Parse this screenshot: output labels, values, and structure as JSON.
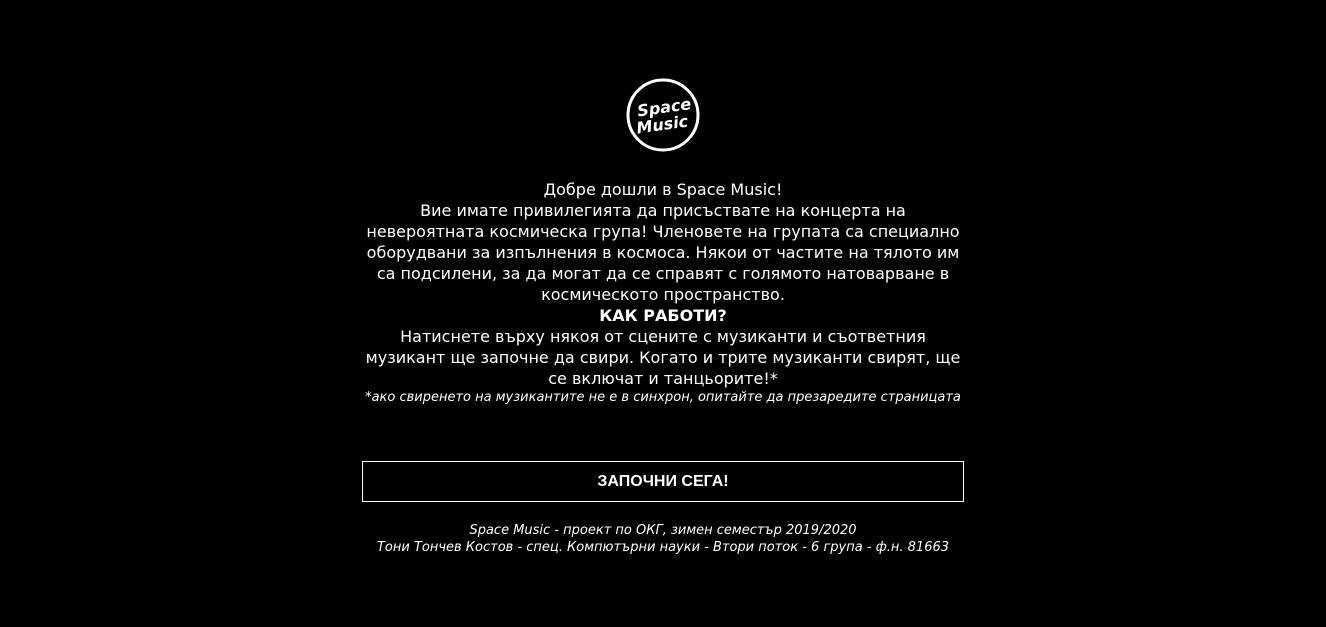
{
  "logo": {
    "line1": "Space",
    "line2": "Music"
  },
  "intro": {
    "welcome": "Добре дошли в Space Music!",
    "description": "Вие имате привилегията да присъствате на концерта на невероятната космическа група! Членовете на групата са специално оборудвани за изпълнения в космоса. Някои от частите на тялото им са подсилени, за да могат да се справят с голямото натоварване в космическото пространство.",
    "how_heading": "КАК РАБОТИ?",
    "how_text": "Натиснете върху някоя от сцените с музиканти и съответния музикант ще започне да свири. Когато и трите музиканти свирят, ще се включат и танцьорите!*",
    "note": "*ако свиренето на музикантите не е в синхрон, опитайте да презаредите страницата"
  },
  "start_button": {
    "label": "ЗАПОЧНИ СЕГА!"
  },
  "footer": {
    "line1": "Space Music - проект по ОКГ, зимен семестър 2019/2020",
    "line2": "Тони Тончев Костов - спец. Компютърни науки - Втори поток - 6 група - ф.н. 81663"
  },
  "colors": {
    "background": "#000000",
    "text": "#ffffff"
  }
}
